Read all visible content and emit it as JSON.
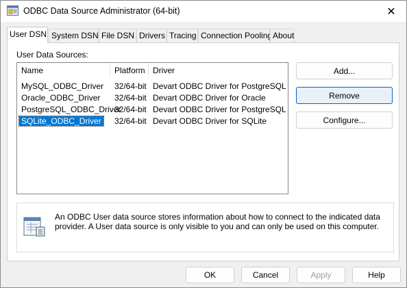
{
  "window": {
    "title": "ODBC Data Source Administrator (64-bit)",
    "close_glyph": "✕"
  },
  "tabs": [
    {
      "label": "User DSN",
      "active": true
    },
    {
      "label": "System DSN"
    },
    {
      "label": "File DSN"
    },
    {
      "label": "Drivers"
    },
    {
      "label": "Tracing"
    },
    {
      "label": "Connection Pooling"
    },
    {
      "label": "About"
    }
  ],
  "user_dsn": {
    "group_label": "User Data Sources:",
    "columns": [
      "Name",
      "Platform",
      "Driver"
    ],
    "rows": [
      {
        "name": "MySQL_ODBC_Driver",
        "platform": "32/64-bit",
        "driver": "Devart ODBC Driver for PostgreSQL"
      },
      {
        "name": "Oracle_ODBC_Driver",
        "platform": "32/64-bit",
        "driver": "Devart ODBC Driver for Oracle"
      },
      {
        "name": "PostgreSQL_ODBC_Driver",
        "platform": "32/64-bit",
        "driver": "Devart ODBC Driver for PostgreSQL"
      },
      {
        "name": "SQLite_ODBC_Driver",
        "platform": "32/64-bit",
        "driver": "Devart ODBC Driver for SQLite",
        "selected": true
      }
    ],
    "buttons": {
      "add": "Add...",
      "remove": "Remove",
      "configure": "Configure..."
    },
    "info_text": "An ODBC User data source stores information about how to connect to the indicated data provider.   A User data source is only visible to you and can only be used on this computer."
  },
  "footer": {
    "ok": "OK",
    "cancel": "Cancel",
    "apply": "Apply",
    "help": "Help"
  },
  "colors": {
    "selection": "#0078d7",
    "default_button_border": "#0067c0"
  }
}
